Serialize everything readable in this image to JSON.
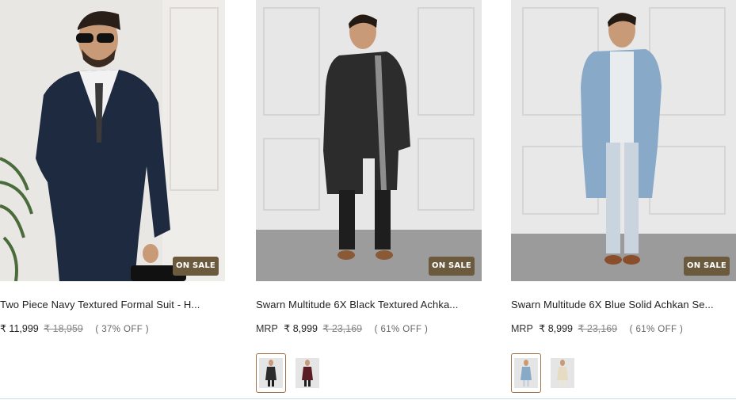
{
  "products": [
    {
      "title": "Two Piece Navy Textured Formal Suit - H...",
      "mrp_label": "",
      "price": "₹ 11,999",
      "original_price": "₹ 18,959",
      "discount": "( 37% OFF )",
      "badge": "ON SALE",
      "swatches": []
    },
    {
      "title": "Swarn Multitude 6X Black Textured Achka...",
      "mrp_label": "MRP",
      "price": "₹ 8,999",
      "original_price": "₹ 23,169",
      "discount": "( 61% OFF )",
      "badge": "ON SALE",
      "swatches": [
        "black",
        "maroon"
      ]
    },
    {
      "title": "Swarn Multitude 6X Blue Solid Achkan Se...",
      "mrp_label": "MRP",
      "price": "₹ 8,999",
      "original_price": "₹ 23,169",
      "discount": "( 61% OFF )",
      "badge": "ON SALE",
      "swatches": [
        "blue",
        "cream"
      ]
    }
  ],
  "colors": {
    "badge_bg": "#6b5a3e",
    "swatch_active_border": "#a0724a"
  }
}
